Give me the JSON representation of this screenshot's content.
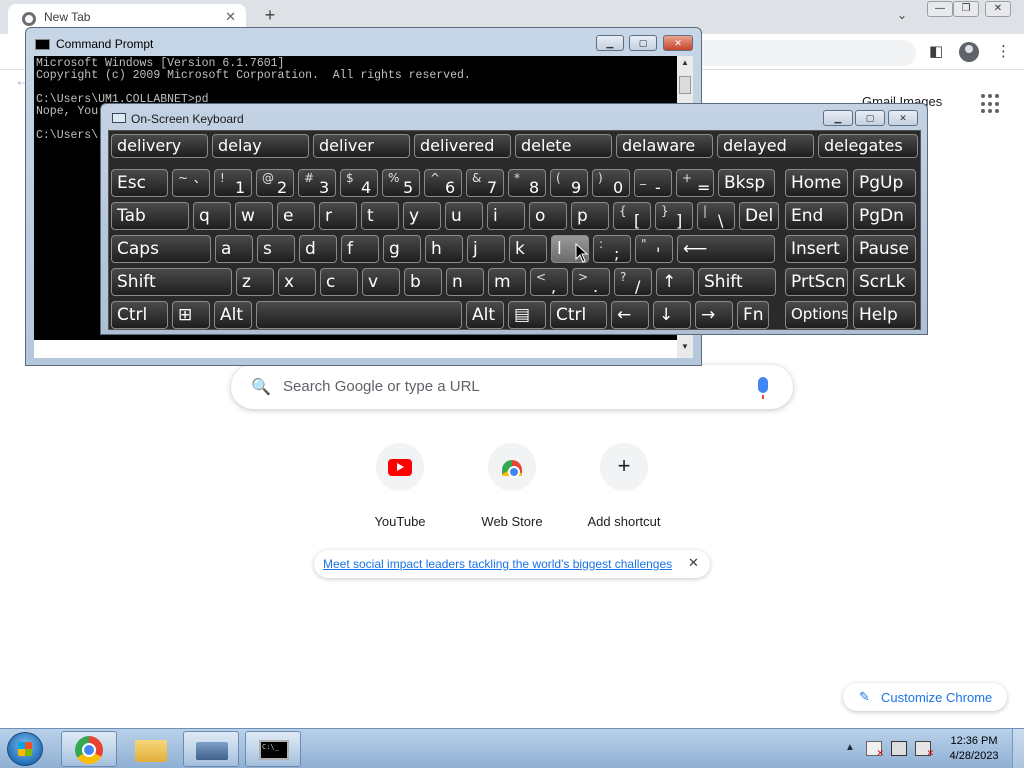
{
  "chrome": {
    "tab_title": "New Tab",
    "close_tab_glyph": "✕",
    "new_tab_glyph": "+",
    "tab_search_glyph": "⌄",
    "window_buttons": [
      "—",
      "❐",
      "✕"
    ],
    "side_panel_glyph": "◧",
    "menu_glyph": "⋮",
    "back_glyph": "←",
    "ntp_links": "Gmail  Images"
  },
  "ntp": {
    "search_placeholder": "Search Google or type a URL",
    "search_icon": "search-icon",
    "shortcuts": [
      {
        "label": "YouTube",
        "icon": "youtube-icon"
      },
      {
        "label": "Web Store",
        "icon": "web-store-icon"
      },
      {
        "label": "Add shortcut",
        "icon": "plus-icon"
      }
    ],
    "promo_text": "Meet social impact leaders tackling the world's biggest challenges",
    "promo_close": "✕",
    "customize_label": "Customize Chrome",
    "customize_icon": "✎",
    "add_glyph": "+",
    "search_glyph": "🔍"
  },
  "cmd": {
    "title": "Command Prompt",
    "lines": [
      "Microsoft Windows [Version 6.1.7601]",
      "Copyright (c) 2009 Microsoft Corporation.  All rights reserved.",
      "",
      "C:\\Users\\UM1.COLLABNET>pd",
      "Nope, You",
      "",
      "C:\\Users\\"
    ],
    "buttons": [
      "▁",
      "▢",
      "✕"
    ],
    "scroll_up": "▲",
    "scroll_down": "▼"
  },
  "osk": {
    "title": "On-Screen Keyboard",
    "buttons": [
      "▁",
      "▢",
      "✕"
    ],
    "predictions": [
      "delivery",
      "delay",
      "deliver",
      "delivered",
      "delete",
      "delaware",
      "delayed",
      "delegates"
    ],
    "row1": [
      {
        "label": "Esc"
      },
      {
        "sub": "~",
        "main": "`"
      },
      {
        "sub": "!",
        "main": "1"
      },
      {
        "sub": "@",
        "main": "2"
      },
      {
        "sub": "#",
        "main": "3"
      },
      {
        "sub": "$",
        "main": "4"
      },
      {
        "sub": "%",
        "main": "5"
      },
      {
        "sub": "^",
        "main": "6"
      },
      {
        "sub": "&",
        "main": "7"
      },
      {
        "sub": "*",
        "main": "8"
      },
      {
        "sub": "(",
        "main": "9"
      },
      {
        "sub": ")",
        "main": "0"
      },
      {
        "sub": "_",
        "main": "-"
      },
      {
        "sub": "+",
        "main": "="
      },
      {
        "label": "Bksp"
      }
    ],
    "row2": [
      {
        "label": "Tab"
      },
      {
        "label": "q"
      },
      {
        "label": "w"
      },
      {
        "label": "e"
      },
      {
        "label": "r"
      },
      {
        "label": "t"
      },
      {
        "label": "y"
      },
      {
        "label": "u"
      },
      {
        "label": "i"
      },
      {
        "label": "o"
      },
      {
        "label": "p"
      },
      {
        "sub": "{",
        "main": "["
      },
      {
        "sub": "}",
        "main": "]"
      },
      {
        "sub": "|",
        "main": "\\"
      },
      {
        "label": "Del"
      }
    ],
    "row3": [
      {
        "label": "Caps"
      },
      {
        "label": "a"
      },
      {
        "label": "s"
      },
      {
        "label": "d"
      },
      {
        "label": "f"
      },
      {
        "label": "g"
      },
      {
        "label": "h"
      },
      {
        "label": "j"
      },
      {
        "label": "k"
      },
      {
        "label": "l"
      },
      {
        "sub": ":",
        "main": ";"
      },
      {
        "sub": "\"",
        "main": "'"
      },
      {
        "label": "⟵"
      }
    ],
    "row4": [
      {
        "label": "Shift"
      },
      {
        "label": "z"
      },
      {
        "label": "x"
      },
      {
        "label": "c"
      },
      {
        "label": "v"
      },
      {
        "label": "b"
      },
      {
        "label": "n"
      },
      {
        "label": "m"
      },
      {
        "sub": "<",
        "main": ","
      },
      {
        "sub": ">",
        "main": "."
      },
      {
        "sub": "?",
        "main": "/"
      },
      {
        "label": "↑"
      },
      {
        "label": "Shift"
      }
    ],
    "row5": [
      {
        "label": "Ctrl"
      },
      {
        "label": "⊞"
      },
      {
        "label": "Alt"
      },
      {
        "label": ""
      },
      {
        "label": "Alt"
      },
      {
        "label": "▤"
      },
      {
        "label": "Ctrl"
      },
      {
        "label": "←"
      },
      {
        "label": "↓"
      },
      {
        "label": "→"
      },
      {
        "label": "Fn"
      }
    ],
    "nav": [
      [
        "Home",
        "PgUp"
      ],
      [
        "End",
        "PgDn"
      ],
      [
        "Insert",
        "Pause"
      ],
      [
        "PrtScn",
        "ScrLk"
      ],
      [
        "Options",
        "Help"
      ]
    ],
    "hovered_key": "l"
  },
  "taskbar": {
    "time": "12:36 PM",
    "date": "4/28/2023",
    "tray_arrow": "▲",
    "cmd_icon_text": "C:\\_"
  }
}
